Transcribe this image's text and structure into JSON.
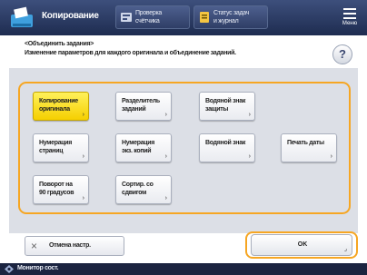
{
  "header": {
    "title": "Копирование",
    "counter_button": {
      "line1": "Проверка",
      "line2": "счётчика",
      "icon": "counter-icon"
    },
    "status_button": {
      "line1": "Статус задач",
      "line2": "и журнал",
      "icon": "status-icon"
    },
    "menu_label": "Меню"
  },
  "instructions": {
    "title": "<Объединить задания>",
    "description": "Изменение параметров для каждого оригинала и объединение заданий."
  },
  "help": {
    "label": "?"
  },
  "options": [
    {
      "line1": "Копирование",
      "line2": "оригинала",
      "selected": true
    },
    {
      "line1": "Разделитель",
      "line2": "заданий",
      "selected": false
    },
    {
      "line1": "Водяной знак",
      "line2": "защиты",
      "selected": false
    },
    {
      "line1": "Нумерация",
      "line2": "страниц",
      "selected": false
    },
    {
      "line1": "Нумерация",
      "line2": "экз. копий",
      "selected": false
    },
    {
      "line1": "Водяной знак",
      "line2": "",
      "selected": false
    },
    {
      "line1": "Печать даты",
      "line2": "",
      "selected": false
    },
    {
      "line1": "Поворот на",
      "line2": "90 градусов",
      "selected": false
    },
    {
      "line1": "Сортир. со",
      "line2": "сдвигом",
      "selected": false
    }
  ],
  "buttons": {
    "close_label": "Отмена настр.",
    "ok_label": "OK"
  },
  "status_bar": {
    "label": "Монитор сост."
  },
  "colors": {
    "header": "#2b3a63",
    "highlight": "#f6a623",
    "selected": "#fce33a",
    "panel": "#dcdfe6"
  }
}
